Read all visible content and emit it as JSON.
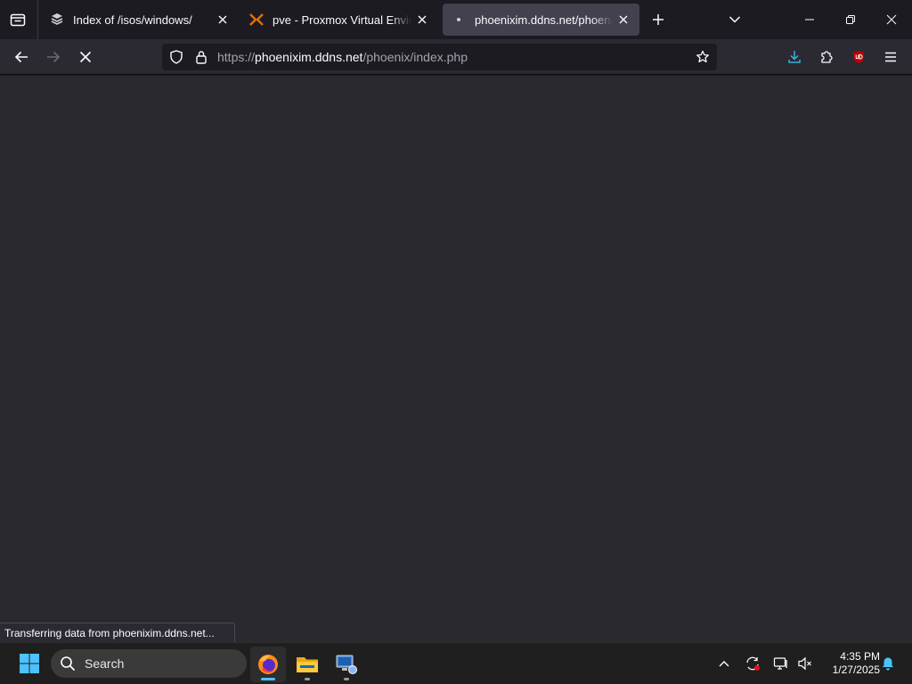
{
  "tabs": [
    {
      "title": "Index of /isos/windows/",
      "favicon": "server-stack-icon",
      "active": false
    },
    {
      "title": "pve - Proxmox Virtual Environment",
      "favicon": "proxmox-x-icon",
      "active": false
    },
    {
      "title": "phoenixim.ddns.net/phoenix/index.php",
      "favicon": "loading-dot-icon",
      "active": true
    }
  ],
  "urlbar": {
    "scheme": "https://",
    "host": "phoenixim.ddns.net",
    "path": "/phoenix/index.php"
  },
  "status": {
    "text": "Transferring data from phoenixim.ddns.net..."
  },
  "taskbar": {
    "search_label": "Search",
    "clock": {
      "time": "4:35 PM",
      "date": "1/27/2025"
    },
    "apps": [
      "firefox-icon",
      "file-explorer-icon",
      "network-app-icon"
    ]
  },
  "colors": {
    "accent": "#4cc2ff",
    "content_bg": "#2a2930",
    "toolbar_bg": "#2b2a33",
    "tabstrip_bg": "#1c1b22",
    "download_icon": "#33b5d9",
    "ublock_red": "#b90000"
  }
}
